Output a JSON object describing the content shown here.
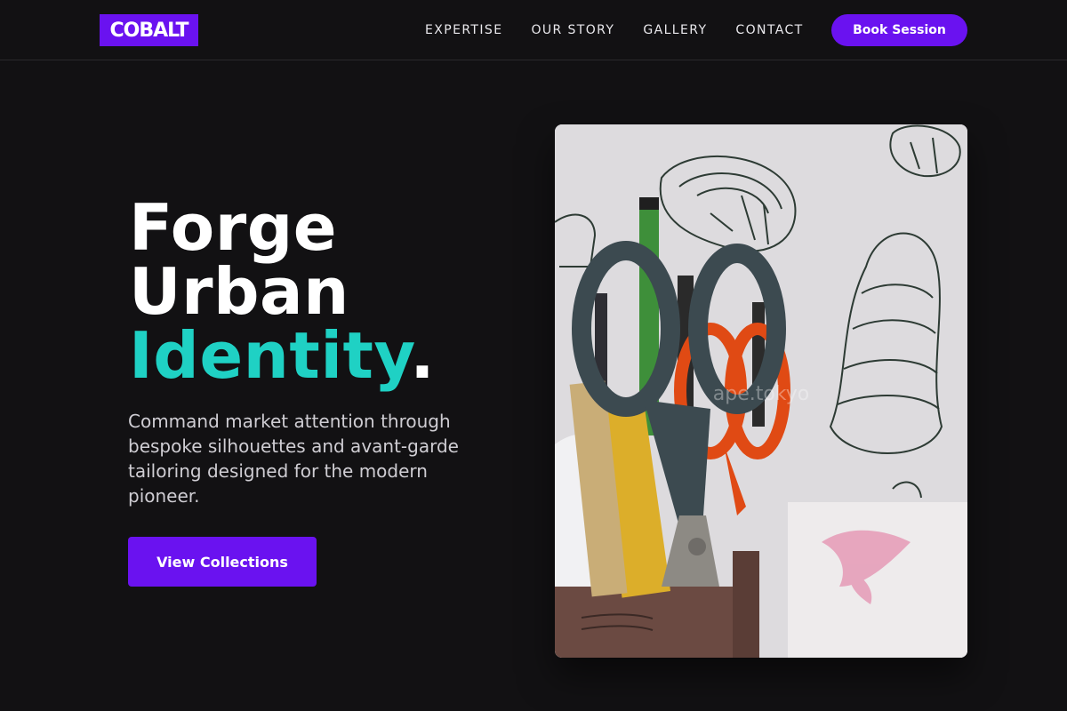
{
  "brand": {
    "logo_text": "COBALT"
  },
  "nav": {
    "links": [
      "EXPERTISE",
      "OUR STORY",
      "GALLERY",
      "CONTACT"
    ],
    "cta_label": "Book Session"
  },
  "hero": {
    "title_line1": "Forge",
    "title_line2": "Urban",
    "title_line3_accent": "Identity",
    "title_line3_end": ".",
    "subtitle": "Command market attention through bespoke silhouettes and avant-garde tailoring designed for the modern pioneer.",
    "cta_label": "View Collections"
  },
  "image": {
    "watermark": "ape.tokyo",
    "subject": "desk organizer with scissors, pencils and pens in front of wall sketches"
  },
  "colors": {
    "background": "#121113",
    "brand_purple": "#6a12f0",
    "accent_teal": "#1fd1c4"
  }
}
